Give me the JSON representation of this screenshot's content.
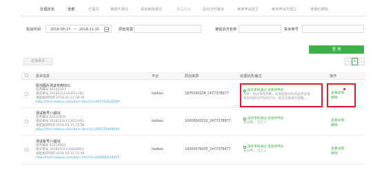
{
  "status_bar": {
    "label": "处理状态",
    "tabs": [
      "全部",
      "已提交",
      "审核不通过",
      "投诉审核通过",
      "小二介入",
      "投诉方已撤诉",
      "卖家申诉成立",
      "卖家申诉不成立",
      "链接已删除"
    ]
  },
  "filters": {
    "time_label": "投诉时间",
    "date_start": "2018-08-13",
    "date_sep": "~",
    "date_end": "2018-11-15",
    "source_label": "原创资源",
    "complainee_label": "被投诉方名称",
    "complaint_no_label": "投诉单号"
  },
  "query_button": "查 询",
  "batch_button": "批量撤诉",
  "pager": {
    "prev": "‹",
    "current": "1",
    "next": "›"
  },
  "table": {
    "headers": {
      "info": "投诉信息",
      "platform": "平台",
      "source": "原创资源",
      "status": "处理状态/备注",
      "action": "操作"
    },
    "rows": [
      {
        "title": "原创图片测试专用001",
        "task_no": "任务编号 84202183",
        "complaint_no": "投诉单号 20181112183022182",
        "time": "发起投诉时间 2018-11-12 18:30",
        "link": "http://item.taobao.com/item.htm?id=607745035599",
        "platform": "taobao",
        "source": "1875043108_2477378977",
        "status_title": "投诉审核通过-卖家待申诉",
        "status_desc_1": "您好，经过审核判断，您发起投诉的商品存在侵",
        "status_desc_2": "权您的知识产权的行为，现已对其进行处理。",
        "actions": [
          "查看详情",
          "撤销"
        ]
      },
      {
        "title": "测试账号八戒01",
        "task_no": "任务编号 83314004",
        "complaint_no": "投诉单号 20181031155652403",
        "time": "发起投诉时间 2018-10-31 15:56",
        "link": "http://item.taobao.com/item.htm?id=606375409040",
        "platform": "taobao",
        "source": "10000042010_2477378977",
        "status_title": "投诉审核通过-卖家待申诉",
        "status_desc_1": "处分例。 已汇入",
        "status_desc_2": "",
        "actions": [
          "查看详情",
          "撤销"
        ]
      },
      {
        "title": "测试账号八戒01",
        "task_no": "任务编号 83314004",
        "complaint_no": "投诉单号 20181031154838003",
        "time": "发起投诉时间 2018-10-31 15:48",
        "link": "http://item.taobao.com/item.htm?id=606805039937",
        "platform": "taobao",
        "source": "10000076005_2477378977",
        "status_title": "投诉审核通过-卖家待申诉",
        "status_desc_1": "处分例。 已汇入",
        "status_desc_2": "",
        "actions": [
          "查看详情",
          "撤销"
        ]
      }
    ]
  },
  "colors": {
    "accent": "#3bb34a",
    "link": "#3aa8d8",
    "highlight": "#e0192b"
  }
}
